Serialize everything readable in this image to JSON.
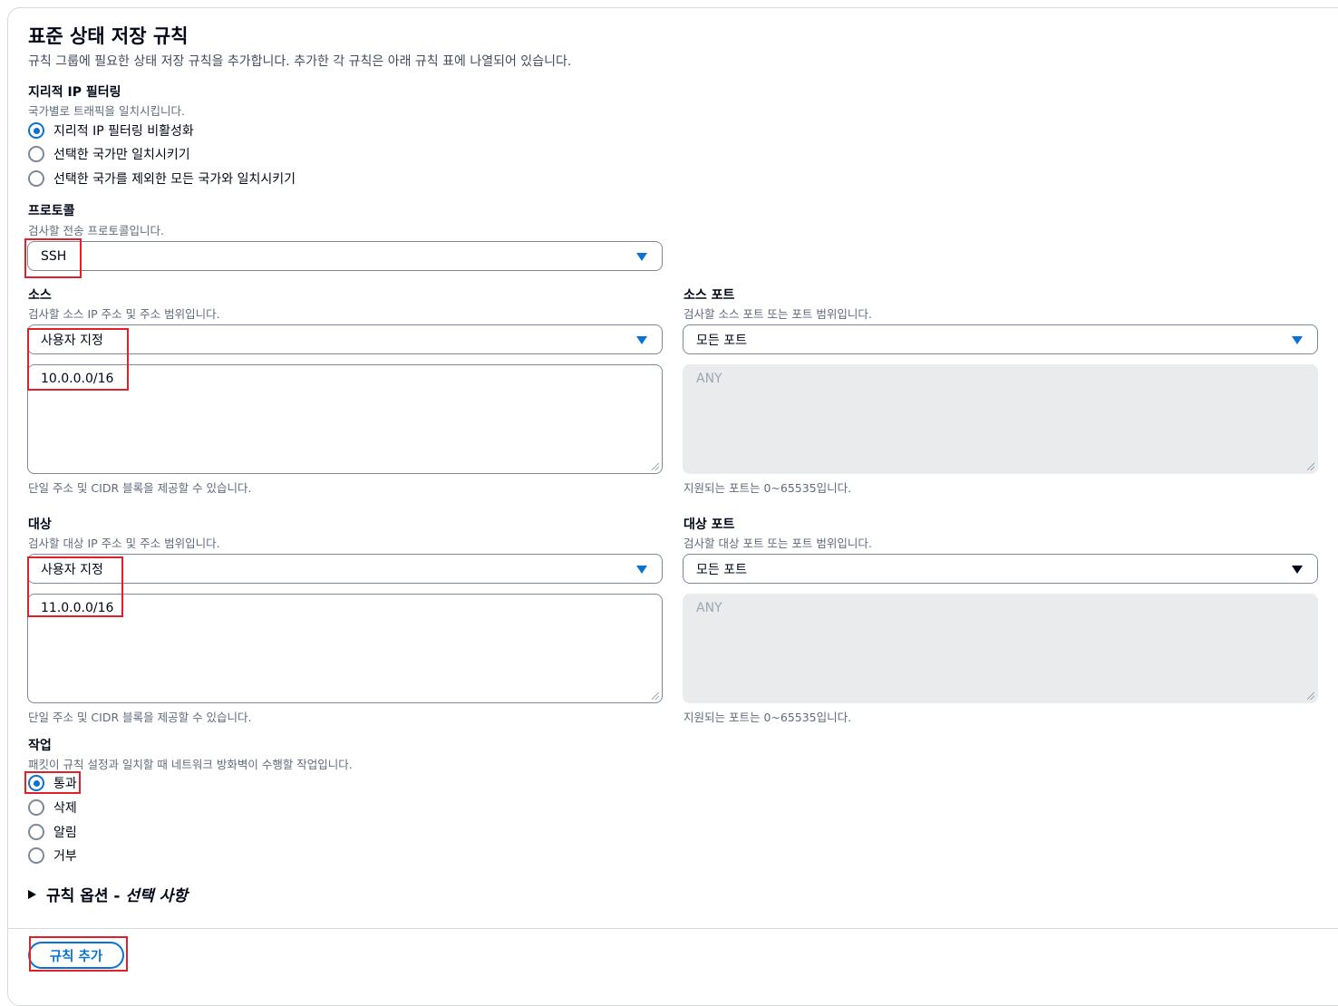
{
  "section": {
    "title": "표준 상태 저장 규칙",
    "description": "규칙 그룹에 필요한 상태 저장 규칙을 추가합니다. 추가한 각 규칙은 아래 규칙 표에 나열되어 있습니다."
  },
  "geo": {
    "label": "지리적 IP 필터링",
    "sub": "국가별로 트래픽을 일치시킵니다.",
    "options": [
      {
        "label": "지리적 IP 필터링 비활성화",
        "selected": true
      },
      {
        "label": "선택한 국가만 일치시키기",
        "selected": false
      },
      {
        "label": "선택한 국가를 제외한 모든 국가와 일치시키기",
        "selected": false
      }
    ]
  },
  "protocol": {
    "label": "프로토콜",
    "sub": "검사할 전송 프로토콜입니다.",
    "value": "SSH"
  },
  "source": {
    "label": "소스",
    "sub": "검사할 소스 IP 주소 및 주소 범위입니다.",
    "select_value": "사용자 지정",
    "text": "10.0.0.0/16",
    "hint": "단일 주소 및 CIDR 블록을 제공할 수 있습니다."
  },
  "source_port": {
    "label": "소스 포트",
    "sub": "검사할 소스 포트 또는 포트 범위입니다.",
    "select_value": "모든 포트",
    "text": "ANY",
    "hint": "지원되는 포트는 0~65535입니다."
  },
  "destination": {
    "label": "대상",
    "sub": "검사할 대상 IP 주소 및 주소 범위입니다.",
    "select_value": "사용자 지정",
    "text": "11.0.0.0/16",
    "hint": "단일 주소 및 CIDR 블록을 제공할 수 있습니다."
  },
  "destination_port": {
    "label": "대상 포트",
    "sub": "검사할 대상 포트 또는 포트 범위입니다.",
    "select_value": "모든 포트",
    "text": "ANY",
    "hint": "지원되는 포트는 0~65535입니다."
  },
  "action": {
    "label": "작업",
    "sub": "패킷이 규칙 설정과 일치할 때 네트워크 방화벽이 수행할 작업입니다.",
    "options": [
      {
        "label": "통과",
        "selected": true
      },
      {
        "label": "삭제",
        "selected": false
      },
      {
        "label": "알림",
        "selected": false
      },
      {
        "label": "거부",
        "selected": false
      }
    ]
  },
  "rule_options": {
    "label": "규칙 옵션 - ",
    "optional": "선택 사항"
  },
  "add_button": {
    "label": "규칙 추가"
  },
  "colors": {
    "accent": "#0972d3",
    "highlight": "#e0202a"
  }
}
